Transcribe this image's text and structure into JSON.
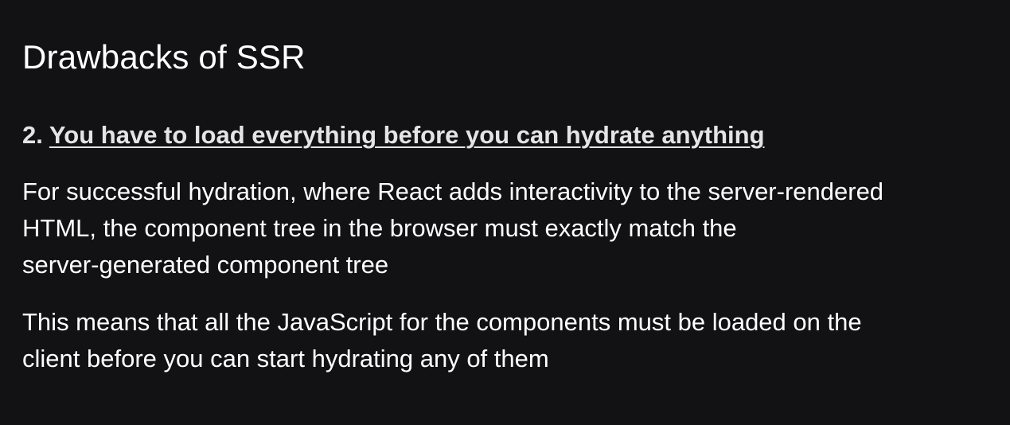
{
  "slide": {
    "title": "Drawbacks of SSR",
    "point_number": "2.",
    "point_text": "You have to load everything before you can hydrate anything",
    "paragraph1_lines": [
      "For successful hydration, where React adds interactivity to the server-rendered",
      "HTML, the component tree in the browser must exactly match the",
      "server-generated component tree"
    ],
    "paragraph2_lines": [
      "This means that all the JavaScript for the components must be loaded on the",
      "client before you can start hydrating any of them"
    ]
  },
  "colors": {
    "background": "#121214",
    "text": "#ffffff",
    "heading_text": "#e4e4e6"
  }
}
